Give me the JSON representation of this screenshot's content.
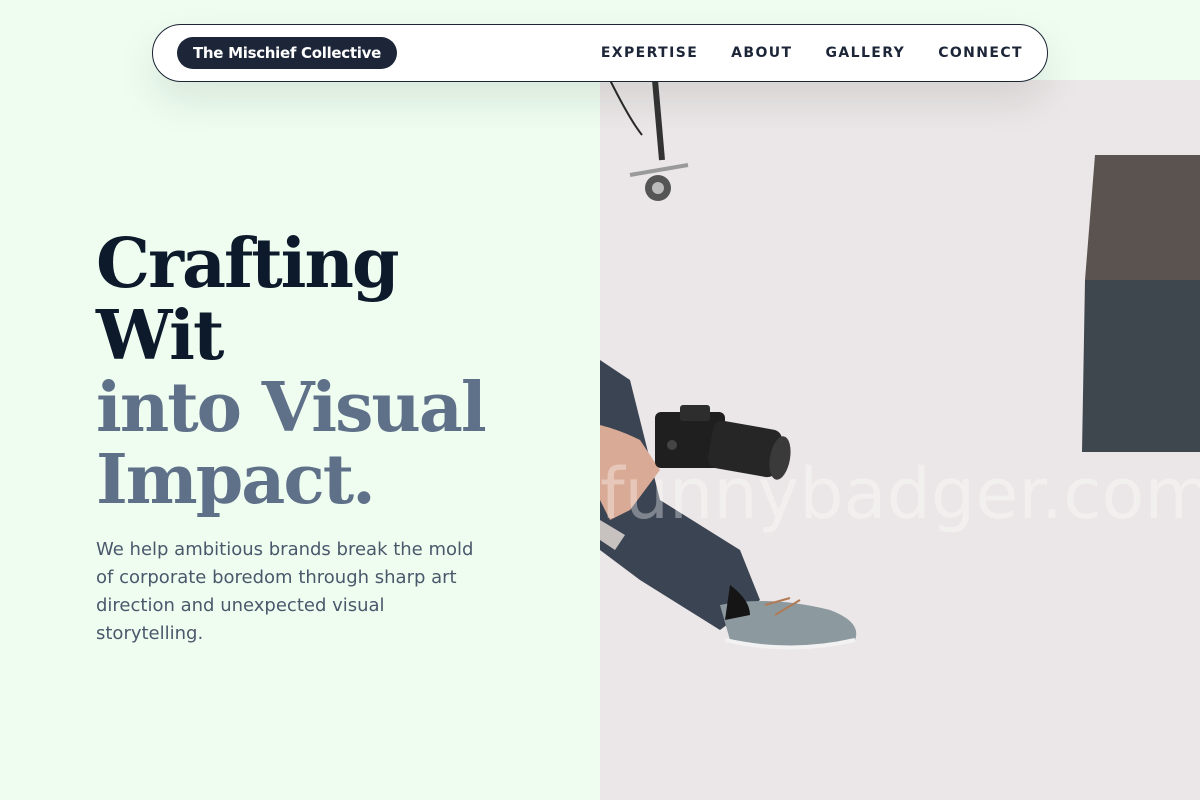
{
  "nav": {
    "brand": "The Mischief Collective",
    "links": [
      "EXPERTISE",
      "ABOUT",
      "GALLERY",
      "CONNECT"
    ]
  },
  "hero": {
    "headline_line1": "Crafting",
    "headline_line2": "Wit",
    "headline_line3": "into Visual",
    "headline_line4": "Impact.",
    "lead": "We help ambitious brands break the mold of corporate boredom through sharp art direction and unexpected visual storytelling.",
    "image_watermark": "funnybadger.com"
  },
  "colors": {
    "background": "#effdf1",
    "ink": "#0d1a2b",
    "muted": "#5f7089",
    "brand_pill": "#1c2638"
  }
}
